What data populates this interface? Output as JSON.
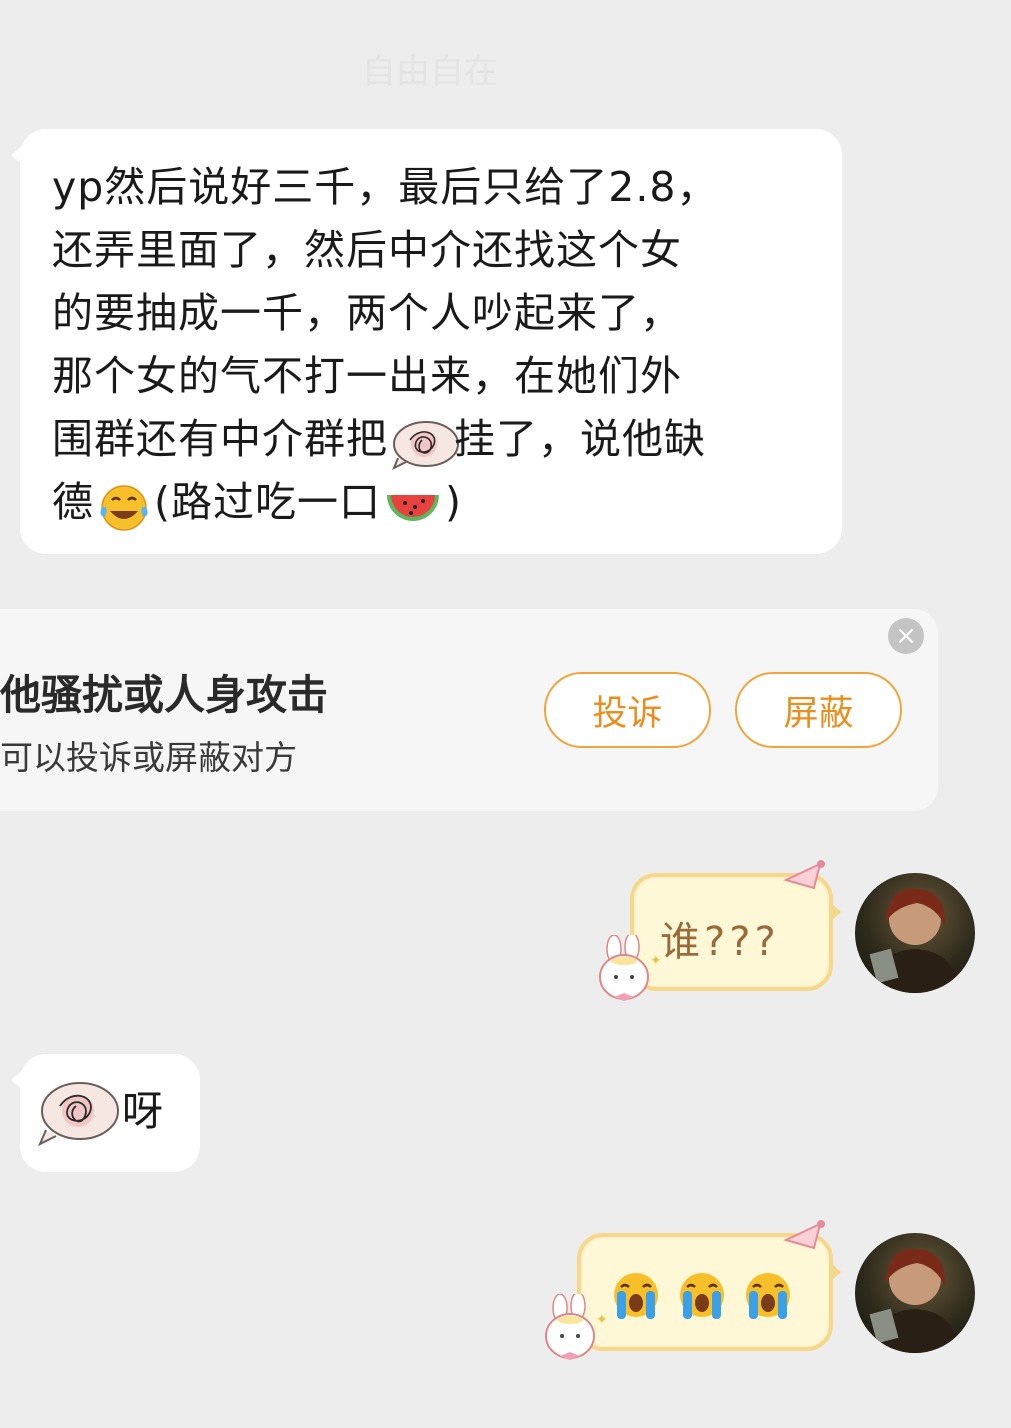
{
  "header": {
    "faint_title": "自由自在"
  },
  "messages": [
    {
      "type": "incoming",
      "lines": [
        {
          "text": "yp然后说好三千，最后只给了2.8，"
        },
        {
          "text": "还弄里面了，然后中介还找这个女"
        },
        {
          "text": "的要抽成一千，两个人吵起来了，"
        },
        {
          "text": "那个女的气不打一出来，在她们外"
        },
        {
          "before": "围群还有中介群把",
          "emoji": "scribble-face-emoji",
          "after": "挂了，说他缺"
        },
        {
          "before": "德",
          "emoji": "laughing-crying-emoji",
          "middle": "(路过吃一口",
          "emoji2": "watermelon-emoji",
          "after": ")"
        }
      ]
    },
    {
      "type": "outgoing",
      "text": "谁???"
    },
    {
      "type": "incoming",
      "emoji": "scribble-face-emoji",
      "text": "呀"
    },
    {
      "type": "outgoing",
      "emojis": [
        "loudly-crying-emoji",
        "loudly-crying-emoji",
        "loudly-crying-emoji"
      ]
    }
  ],
  "safety_banner": {
    "title": "他骚扰或人身攻击",
    "subtitle": "可以投诉或屏蔽对方",
    "report_label": "投诉",
    "block_label": "屏蔽",
    "close_icon": "×"
  },
  "colors": {
    "background": "#ededed",
    "accent_orange": "#f0a53a",
    "bubble_out_bg": "#fff8d6",
    "bubble_out_border": "#f7d78a"
  }
}
